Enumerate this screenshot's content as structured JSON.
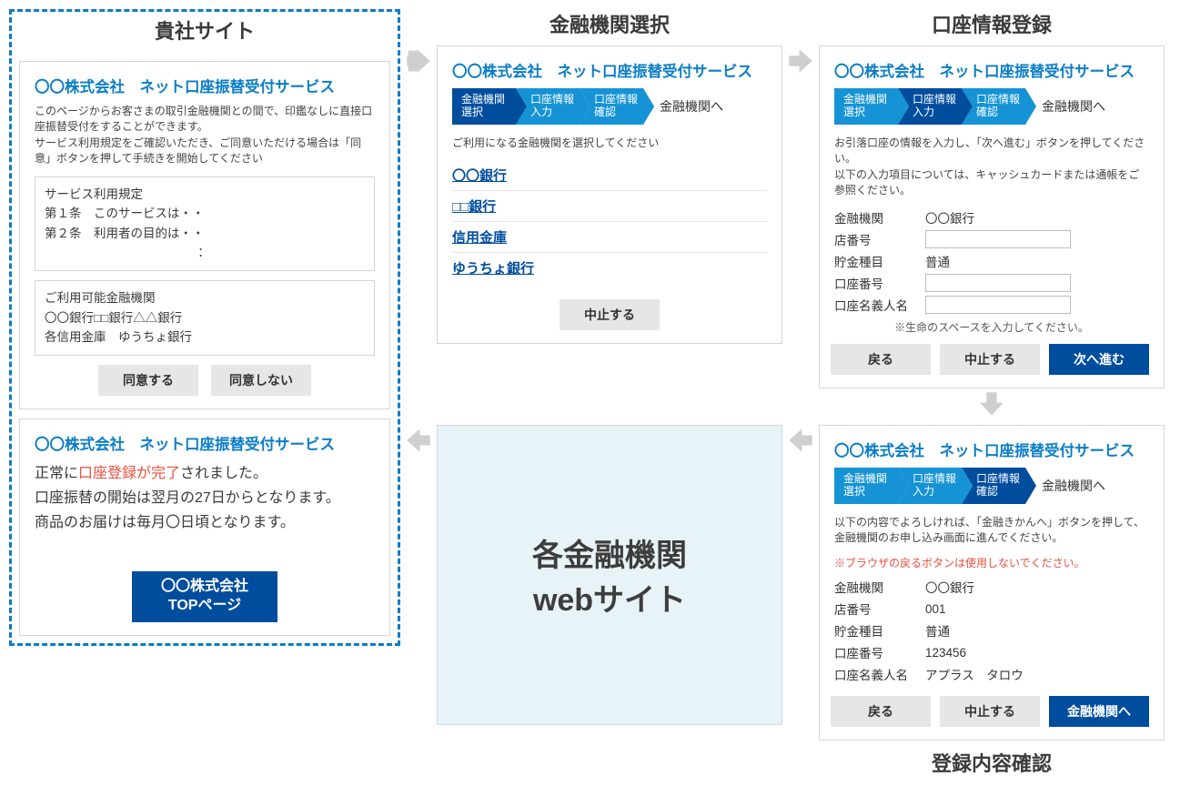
{
  "columns": {
    "left": "貴社サイト",
    "mid": "金融機関選択",
    "right": "口座情報登録",
    "confirm_caption": "登録内容確認"
  },
  "service_title": "〇〇株式会社　ネット口座振替受付サービス",
  "consent": {
    "desc": "このページからお客さまの取引金融機関との間で、印鑑なしに直接口座振替受付をすることができます。\nサービス利用規定をご確認いただき、ご同意いただける場合は「同意」ボタンを押して手続きを開始してください",
    "terms_title": "サービス利用規定",
    "terms_line1": "第１条　このサービスは・・",
    "terms_line2": "第２条　利用者の目的は・・",
    "banks_title": "ご利用可能金融機関",
    "banks_line1": "〇〇銀行□□銀行△△銀行",
    "banks_line2": "各信用金庫　ゆうちょ銀行",
    "agree": "同意する",
    "disagree": "同意しない"
  },
  "complete": {
    "line_pre": "正常に",
    "line_hl": "口座登録が完了",
    "line_post": "されました。",
    "line2": "口座振替の開始は翌月の27日からとなります。",
    "line3": "商品のお届けは毎月〇日頃となります。",
    "top_btn_l1": "〇〇株式会社",
    "top_btn_l2": "TOPページ"
  },
  "steps": {
    "s1": "金融機関\n選択",
    "s2": "口座情報\n入力",
    "s3": "口座情報\n確認",
    "end": "金融機関へ"
  },
  "select": {
    "prompt": "ご利用になる金融機関を選択してください",
    "items": [
      "〇〇銀行",
      "□□銀行",
      "信用金庫",
      "ゆうちょ銀行"
    ],
    "cancel": "中止する"
  },
  "entry": {
    "desc": "お引落口座の情報を入力し、「次へ進む」ボタンを押してください。\n以下の入力項目については、キャッシュカードまたは通帳をご参照ください。",
    "labels": {
      "bank": "金融機関",
      "branch": "店番号",
      "type": "貯金種目",
      "acct": "口座番号",
      "name": "口座名義人名"
    },
    "bank_value": "〇〇銀行",
    "type_value": "普通",
    "note": "※生命のスペースを入力してください。",
    "back": "戻る",
    "cancel": "中止する",
    "next": "次へ進む"
  },
  "confirm": {
    "desc": "以下の内容でよろしければ、「金融きかんへ」ボタンを押して、金融機関のお申し込み画面に進んでください。",
    "warn": "※ブラウザの戻るボタンは使用しないでください。",
    "values": {
      "bank": "〇〇銀行",
      "branch": "001",
      "type": "普通",
      "acct": "123456",
      "name": "アプラス　タロウ"
    },
    "back": "戻る",
    "cancel": "中止する",
    "go": "金融機関へ"
  },
  "center": {
    "l1": "各金融機関",
    "l2": "webサイト"
  }
}
